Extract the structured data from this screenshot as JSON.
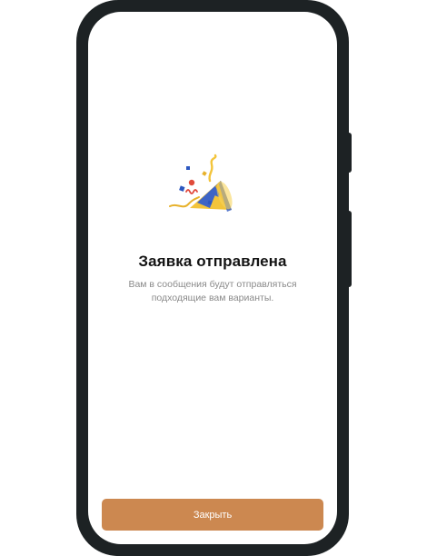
{
  "dialog": {
    "title": "Заявка отправлена",
    "message_line1": "Вам в сообщения будут отправляться",
    "message_line2": "подходящие вам варианты.",
    "icon": "party-popper-icon"
  },
  "actions": {
    "close_label": "Закрыть"
  },
  "colors": {
    "accent": "#cc8850",
    "phone_frame": "#1d2224",
    "title_text": "#141414",
    "subtitle_text": "#8a8a8a"
  }
}
